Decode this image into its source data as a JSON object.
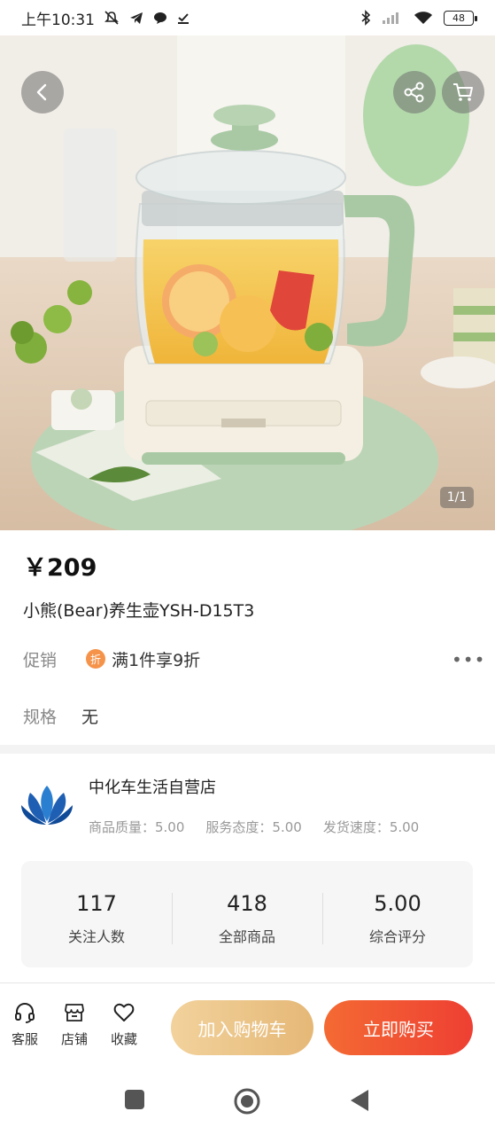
{
  "status_bar": {
    "time": "上午10:31",
    "battery": "48"
  },
  "hero": {
    "image_counter": "1/1"
  },
  "product": {
    "price": "￥209",
    "title": "小熊(Bear)养生壶YSH-D15T3",
    "promo_label": "促销",
    "promo_badge": "折",
    "promo_text": "满1件享9折",
    "spec_label": "规格",
    "spec_value": "无"
  },
  "store": {
    "name": "中化车生活自营店",
    "ratings": [
      "商品质量：5.00",
      "服务态度：5.00",
      "发货速度：5.00"
    ],
    "stats": [
      {
        "value": "117",
        "label": "关注人数"
      },
      {
        "value": "418",
        "label": "全部商品"
      },
      {
        "value": "5.00",
        "label": "综合评分"
      }
    ]
  },
  "actions": {
    "service": "客服",
    "shop": "店铺",
    "favorite": "收藏",
    "add_to_cart": "加入购物车",
    "buy_now": "立即购买"
  },
  "icons": {
    "back": "chevron-left-icon",
    "share": "share-icon",
    "cart": "cart-icon",
    "service": "headset-icon",
    "shop": "store-icon",
    "favorite": "heart-icon"
  },
  "colors": {
    "buy": "#ee3f33",
    "cart": "#e5b877",
    "promo_badge": "#f5934a",
    "kettle_green": "#a9c9a4"
  }
}
